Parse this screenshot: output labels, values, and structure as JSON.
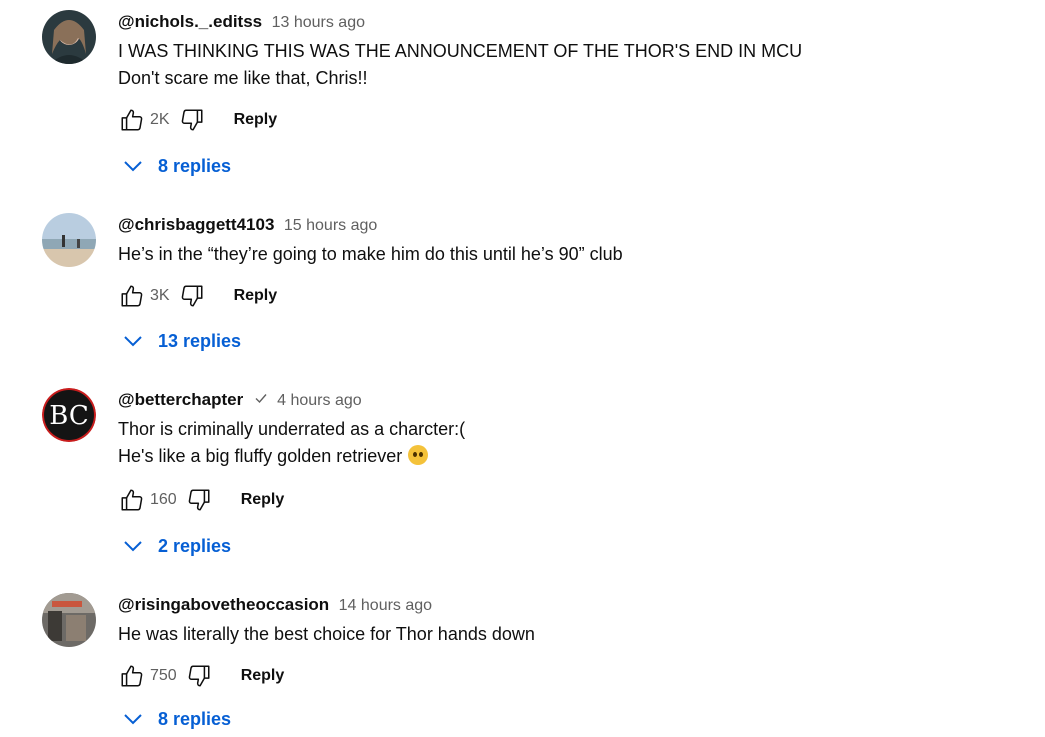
{
  "comments": [
    {
      "author": "@nichols._.editss",
      "time": "13 hours ago",
      "lines": [
        "I WAS THINKING THIS WAS THE ANNOUNCEMENT OF THE THOR'S END IN MCU",
        "Don't scare me like that, Chris!!"
      ],
      "likes": "2K",
      "reply_label": "Reply",
      "replies_label": "8 replies"
    },
    {
      "author": "@chrisbaggett4103",
      "time": "15 hours ago",
      "lines": [
        "He’s in the “they’re going to make him do this until he’s 90” club"
      ],
      "likes": "3K",
      "reply_label": "Reply",
      "replies_label": "13 replies"
    },
    {
      "author": "@betterchapter",
      "verified": true,
      "time": "4 hours ago",
      "lines": [
        "Thor is criminally underrated as a charcter:(",
        "He's like a big fluffy golden retriever"
      ],
      "emoji": "pleading-face-emoji",
      "likes": "160",
      "reply_label": "Reply",
      "replies_label": "2 replies"
    },
    {
      "author": "@risingabovetheoccasion",
      "time": "14 hours ago",
      "lines": [
        "He was literally the best choice for Thor hands down"
      ],
      "likes": "750",
      "reply_label": "Reply",
      "replies_label": "8 replies"
    }
  ],
  "icons": {
    "like": "thumb-up-icon",
    "dislike": "thumb-down-icon",
    "expand": "chevron-down-icon",
    "verified": "check-icon"
  },
  "colors": {
    "link": "#065fd4",
    "secondary": "#606060",
    "text": "#0f0f0f"
  }
}
